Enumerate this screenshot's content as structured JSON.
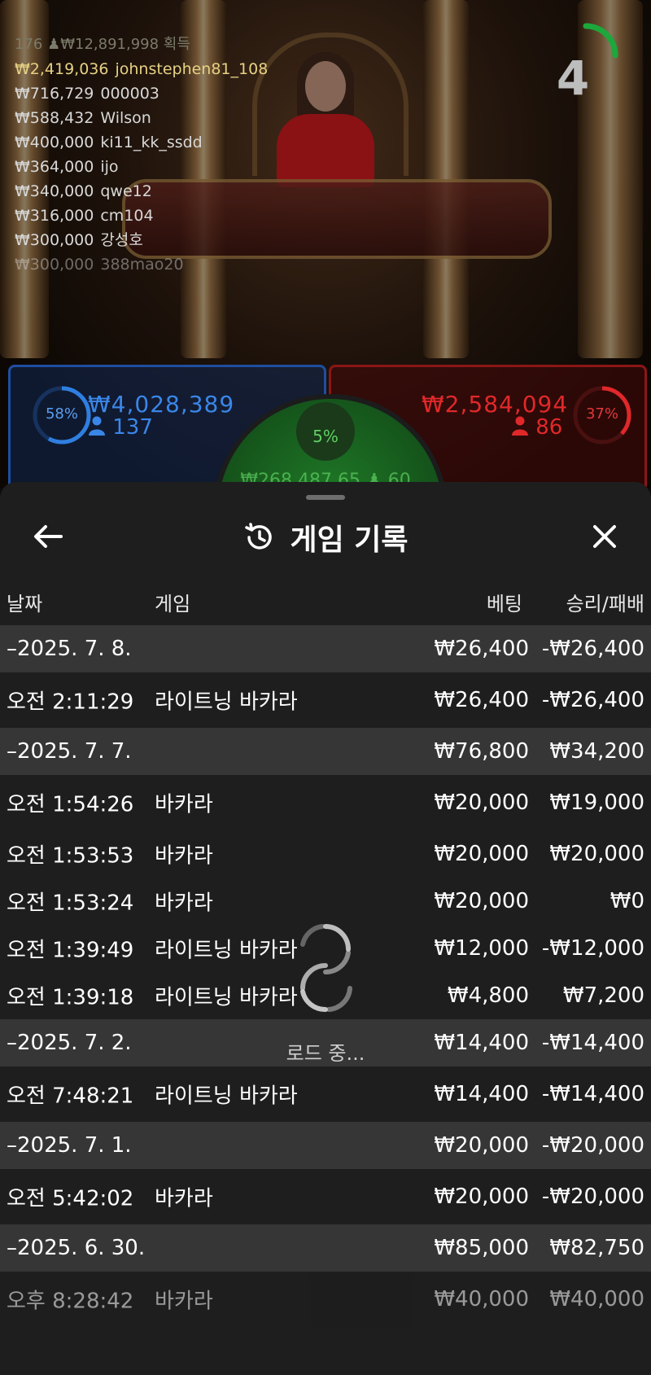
{
  "stream": {
    "winners_header": "176 ♟₩12,891,998 획득",
    "winners": [
      {
        "amount": "₩2,419,036",
        "name": "johnstephen81_108"
      },
      {
        "amount": "₩716,729",
        "name": "000003"
      },
      {
        "amount": "₩588,432",
        "name": "Wilson"
      },
      {
        "amount": "₩400,000",
        "name": "ki11_kk_ssdd"
      },
      {
        "amount": "₩364,000",
        "name": "ijo"
      },
      {
        "amount": "₩340,000",
        "name": "qwe12"
      },
      {
        "amount": "₩316,000",
        "name": "cm104"
      },
      {
        "amount": "₩300,000",
        "name": "강성호"
      },
      {
        "amount": "₩300,000",
        "name": "388mao20"
      }
    ],
    "timer": "4"
  },
  "bets": {
    "player": {
      "percent": "58%",
      "percent_value": 0.58,
      "amount": "₩4,028,389",
      "count": "137",
      "color": "#2f7fe0"
    },
    "banker": {
      "percent": "37%",
      "percent_value": 0.37,
      "amount": "₩2,584,094",
      "count": "86",
      "color": "#e0282a"
    },
    "tie": {
      "percent": "5%",
      "amount": "₩268,487.65 ♟ 60",
      "color": "#3ec444"
    }
  },
  "history": {
    "title": "게임 기록",
    "columns": {
      "date": "날짜",
      "game": "게임",
      "bet": "베팅",
      "result": "승리/패배"
    },
    "groups": [
      {
        "date": "–2025. 7. 8.",
        "bet": "₩26,400",
        "result": "-₩26,400",
        "items": [
          {
            "time": "오전 2:11:29",
            "game": "라이트닝 바카라",
            "bet": "₩26,400",
            "result": "-₩26,400"
          }
        ]
      },
      {
        "date": "–2025. 7. 7.",
        "bet": "₩76,800",
        "result": "₩34,200",
        "items": [
          {
            "time": "오전 1:54:26",
            "game": "바카라",
            "bet": "₩20,000",
            "result": "₩19,000"
          },
          {
            "time": "오전 1:53:53",
            "game": "바카라",
            "bet": "₩20,000",
            "result": "₩20,000"
          },
          {
            "time": "오전 1:53:24",
            "game": "바카라",
            "bet": "₩20,000",
            "result": "₩0"
          },
          {
            "time": "오전 1:39:49",
            "game": "라이트닝 바카라",
            "bet": "₩12,000",
            "result": "-₩12,000"
          },
          {
            "time": "오전 1:39:18",
            "game": "라이트닝 바카라",
            "bet": "₩4,800",
            "result": "₩7,200"
          }
        ]
      },
      {
        "date": "–2025. 7. 2.",
        "bet": "₩14,400",
        "result": "-₩14,400",
        "items": [
          {
            "time": "오전 7:48:21",
            "game": "라이트닝 바카라",
            "bet": "₩14,400",
            "result": "-₩14,400"
          }
        ]
      },
      {
        "date": "–2025. 7. 1.",
        "bet": "₩20,000",
        "result": "-₩20,000",
        "items": [
          {
            "time": "오전 5:42:02",
            "game": "바카라",
            "bet": "₩20,000",
            "result": "-₩20,000"
          }
        ]
      },
      {
        "date": "–2025. 6. 30.",
        "bet": "₩85,000",
        "result": "₩82,750",
        "items": [
          {
            "time": "오후 8:28:42",
            "game": "바카라",
            "bet": "₩40,000",
            "result": "₩40,000"
          }
        ]
      }
    ],
    "loading_text": "로드 중..."
  },
  "icons": {
    "back": "arrow-left-icon",
    "close": "close-icon",
    "history": "history-clock-icon",
    "loader": "spinner-icon",
    "person": "person-icon"
  }
}
